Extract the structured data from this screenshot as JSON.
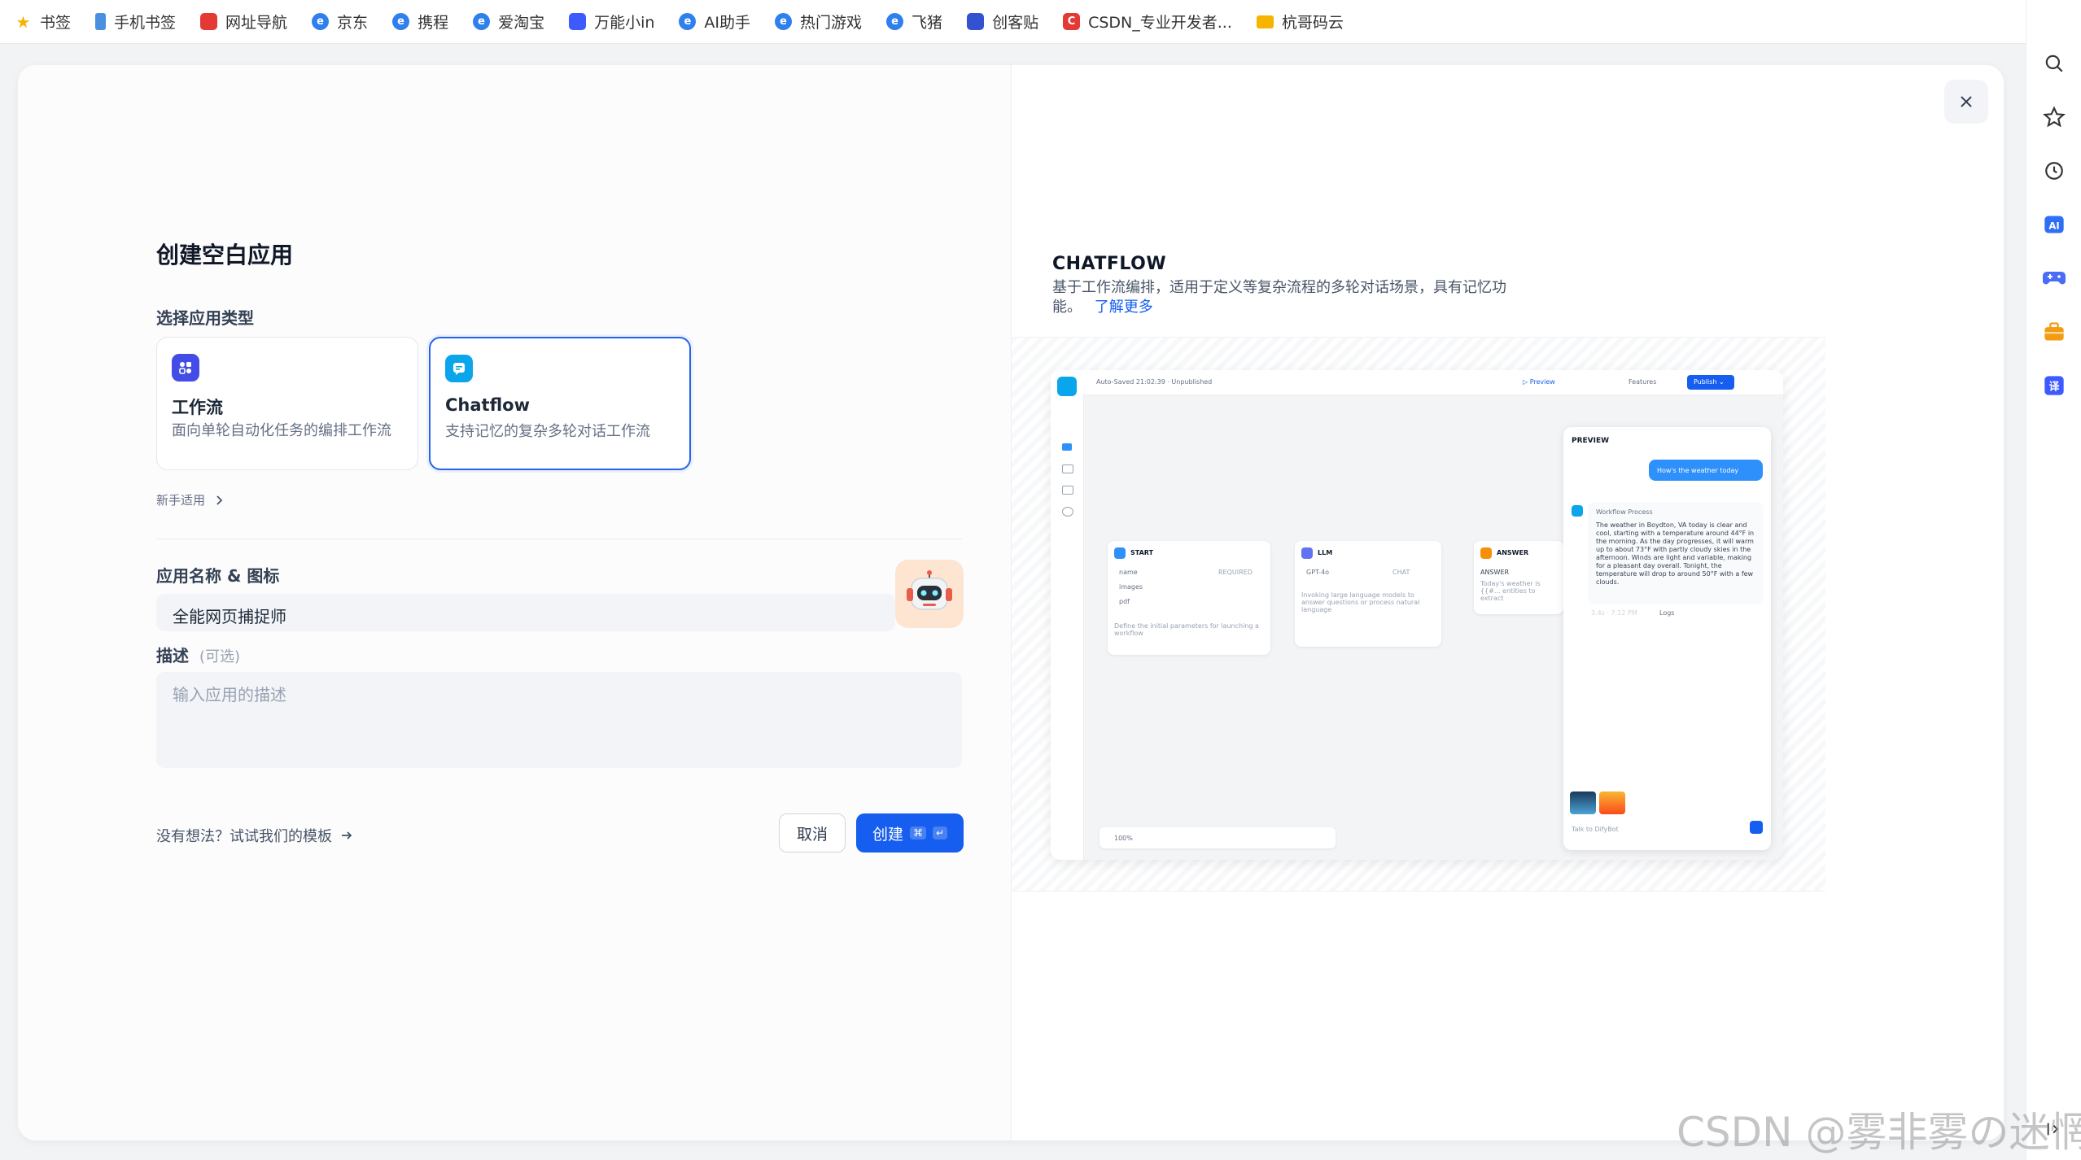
{
  "bookmarks": [
    {
      "label": "书签",
      "icon": "star-icon",
      "color": "#f5b400"
    },
    {
      "label": "手机书签",
      "icon": "phone-icon",
      "color": "#4a90e2"
    },
    {
      "label": "网址导航",
      "icon": "navigation-icon",
      "color": "#e53935"
    },
    {
      "label": "京东",
      "icon": "browser-icon",
      "color": "#2f80ed"
    },
    {
      "label": "携程",
      "icon": "browser-icon",
      "color": "#2f80ed"
    },
    {
      "label": "爱淘宝",
      "icon": "browser-icon",
      "color": "#2f80ed"
    },
    {
      "label": "万能小in",
      "icon": "robot-icon",
      "color": "#3d5afe"
    },
    {
      "label": "AI助手",
      "icon": "browser-icon",
      "color": "#2f80ed"
    },
    {
      "label": "热门游戏",
      "icon": "browser-icon",
      "color": "#2f80ed"
    },
    {
      "label": "飞猪",
      "icon": "browser-icon",
      "color": "#2f80ed"
    },
    {
      "label": "创客贴",
      "icon": "shield-icon",
      "color": "#3451d1"
    },
    {
      "label": "CSDN_专业开发者...",
      "icon": "csdn-icon",
      "color": "#e53935"
    },
    {
      "label": "杭哥码云",
      "icon": "folder-icon",
      "color": "#f5b400"
    }
  ],
  "dialog": {
    "title": "创建空白应用",
    "type_label": "选择应用类型",
    "types": [
      {
        "name": "工作流",
        "desc": "面向单轮自动化任务的编排工作流",
        "color": "#444ce7"
      },
      {
        "name": "Chatflow",
        "desc": "支持记忆的复杂多轮对话工作流",
        "color": "#0ba5ec"
      }
    ],
    "beginner": "新手适用",
    "name_label": "应用名称 & 图标",
    "name_value": "全能网页捕捉师",
    "desc_label": "描述",
    "desc_optional": "(可选)",
    "desc_placeholder": "输入应用的描述",
    "template_link": "没有想法？试试我们的模板",
    "cancel": "取消",
    "create": "创建",
    "create_kbd1": "⌘",
    "create_kbd2": "↵"
  },
  "info": {
    "title": "CHATFLOW",
    "desc": "基于工作流编排，适用于定义等复杂流程的多轮对话场景，具有记忆功能。",
    "learn_more": "了解更多"
  },
  "mock": {
    "autosave": "Auto-Saved 21:02:39 · Unpublished",
    "preview_btn": "▷ Preview",
    "features": "Features",
    "publish": "Publish ⌄",
    "preview_title": "PREVIEW",
    "user_msg": "How's the weather today",
    "workflow_process": "Workflow Process",
    "bot_reply": "The weather in Boydton, VA today is clear and cool, starting with a temperature around 44°F in the morning. As the day progresses, it will warm up to about 73°F with partly cloudy skies in the afternoon. Winds are light and variable, making for a pleasant day overall. Tonight, the temperature will drop to around 50°F with a few clouds.",
    "logs": "Logs",
    "time": "3.4s · 7:12 PM",
    "input_ph": "Talk to DifyBot",
    "zoom": "100%",
    "start": "START",
    "start_fields": [
      "name",
      "images",
      "pdf"
    ],
    "start_badge": "REQUIRED",
    "start_note": "Define the initial parameters for launching a workflow",
    "llm": "LLM",
    "llm_model": "GPT-4o",
    "llm_badge": "CHAT",
    "llm_note": "Invoking large language models to answer questions or process natural language",
    "answer": "ANSWER",
    "answer_label": "ANSWER",
    "answer_note": "Today's weather is {{#... entities to extract"
  },
  "watermark": "CSDN @雾非雾の迷惘"
}
